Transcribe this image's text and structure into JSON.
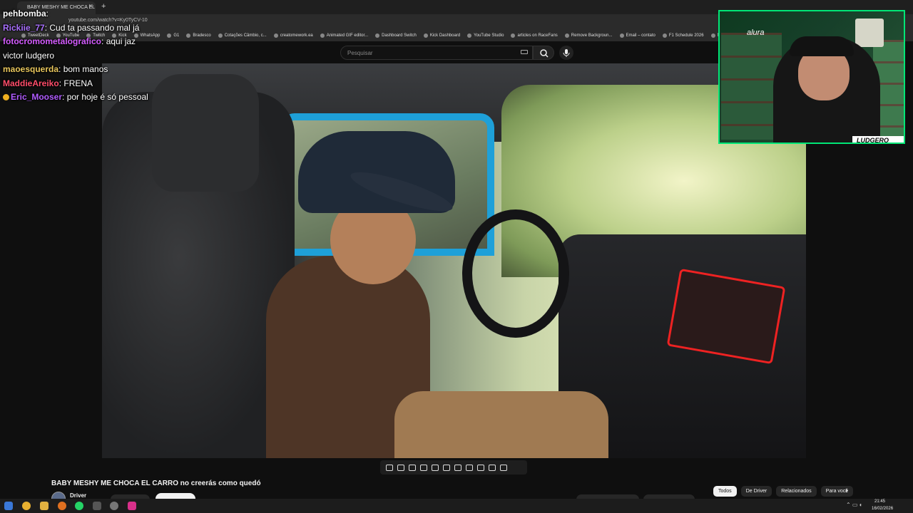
{
  "browser": {
    "tab_title": "BABY MESHY ME CHOCA EL CA",
    "url": "youtube.com/watch?v=Ky0TyCV-10",
    "bookmarks": [
      "TweetDeck",
      "YouTube",
      "Twitch",
      "Kick",
      "WhatsApp",
      "G1",
      "Bradesco",
      "Cotações Câmbio, c...",
      "creatomework.ea",
      "Animated GIF editor...",
      "Dashboard Switch",
      "Kick Dashboard",
      "YouTube Studio",
      "articles on RaceFans",
      "Remove Backgroun...",
      "Email – contato",
      "F1 Schedule 2026",
      "Not"
    ]
  },
  "youtube": {
    "search_placeholder": "Pesquisar",
    "video_title": "BABY MESHY ME CHOCA EL CARRO no creerás como quedó",
    "channel": "Driver",
    "chips": [
      "Todos",
      "De Driver",
      "Relacionados",
      "Para você"
    ]
  },
  "chat": [
    {
      "user": "pehbomba",
      "text": "",
      "color": "#ffffff"
    },
    {
      "user": "Rickiie_77",
      "text": "Cud ta passando mal já",
      "color": "#a970ff"
    },
    {
      "user": "fotocromometalografico",
      "text": "aqui jaz victor ludgero",
      "color": "#d45cff"
    },
    {
      "user": "maoesquerda",
      "text": "bom manos",
      "color": "#e8c65c"
    },
    {
      "user": "MaddieAreiko",
      "text": "FRENA",
      "color": "#ff4d6a"
    },
    {
      "user": "Eric_Mooser",
      "text": "por hoje é só pessoal",
      "color": "#b15cff"
    }
  ],
  "webcam": {
    "label": "alura",
    "name_tag": "LUDGERO"
  },
  "taskbar": {
    "time": "21:45",
    "date": "16/02/2026"
  },
  "colors": {
    "webcam_border": "#00e676",
    "door_blue": "#1ea0d8"
  }
}
